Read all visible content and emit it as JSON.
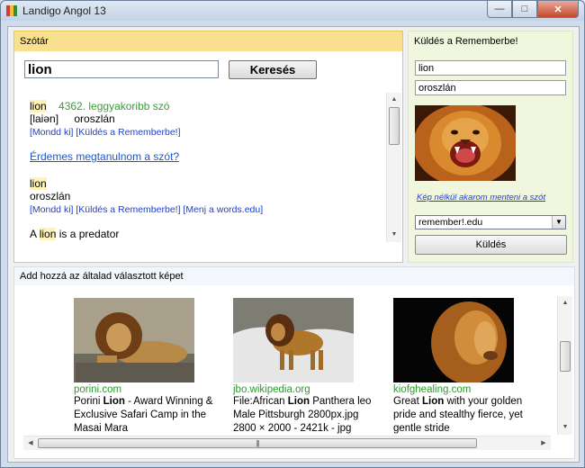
{
  "window": {
    "title": "Landigo Angol 13",
    "minimize_icon": "minimize-icon",
    "maximize_icon": "maximize-icon",
    "close_icon": "close-icon"
  },
  "dictionary": {
    "header": "Szótár",
    "search_value": "lion",
    "search_button": "Keresés",
    "entry_word": "lion",
    "rank_text": "4362. leggyakoribb szó",
    "phonetic": "[laiən]",
    "translation": "oroszlán",
    "links1": "[Mondd ki] [Küldés a Remembe!]",
    "links1_full": "[Mondd ki] [Küldés a Rememberbe!]",
    "learn_question": "Érdemes megtanulnom a szót?",
    "entry2_word": "lion",
    "entry2_translation": "oroszlán",
    "links2": "[Mondd ki] [Küldés a Rememberbe!] [Menj a words.edu]",
    "example_prefix": "A ",
    "example_word": "lion",
    "example_suffix": " is a predator"
  },
  "send_panel": {
    "header": "Küldés a Rememberbe!",
    "word_value": "lion",
    "translation_value": "oroszlán",
    "no_image_link": "Kép nélkül akarom menteni a szót",
    "select_value": "remember!.edu",
    "send_button": "Küldés"
  },
  "images_panel": {
    "header": "Add hozzá az általad választott képet",
    "cards": [
      {
        "source": "porini.com",
        "desc_pre": "Porini ",
        "desc_bold": "Lion",
        "desc_post": " - Award Winning & Exclusive Safari Camp in the Masai Mara"
      },
      {
        "source": "jbo.wikipedia.org",
        "desc_pre": "File:African ",
        "desc_bold": "Lion",
        "desc_post": " Panthera leo Male Pittsburgh 2800px.jpg",
        "desc_line2": "2800 × 2000 - 2421k - jpg"
      },
      {
        "source": "kiofghealing.com",
        "desc_pre": "Great ",
        "desc_bold": "Lion",
        "desc_post": " with your golden pride and stealthy fierce, yet gentle stride"
      }
    ]
  },
  "colors": {
    "dict_header": "#f8e08e",
    "send_panel": "#f1f7df",
    "link": "#1f3fd0",
    "source_green": "#2a9a2a"
  }
}
